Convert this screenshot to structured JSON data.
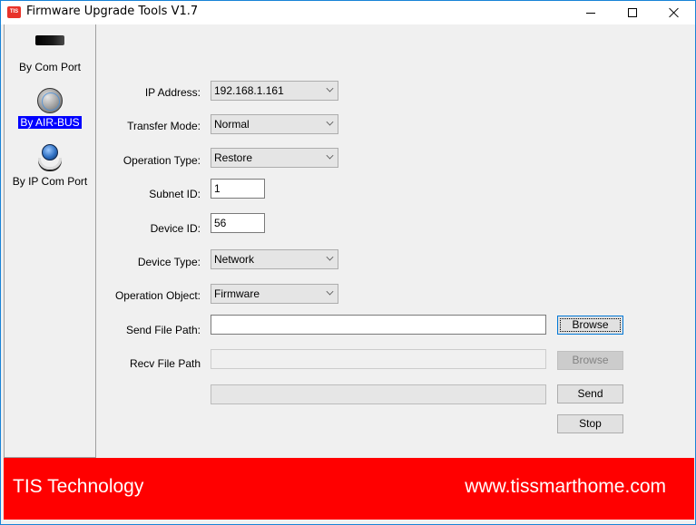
{
  "window": {
    "title": "Firmware Upgrade Tools V1.7",
    "app_icon_text": "TIS"
  },
  "sidebar": {
    "items": [
      {
        "label": "By Com Port",
        "icon": "com-port-icon",
        "selected": false
      },
      {
        "label": "By AIR-BUS",
        "icon": "globe-icon",
        "selected": true
      },
      {
        "label": "By IP Com Port",
        "icon": "ip-network-icon",
        "selected": false
      }
    ]
  },
  "form": {
    "ip_address": {
      "label": "IP Address:",
      "value": "192.168.1.161"
    },
    "transfer_mode": {
      "label": "Transfer Mode:",
      "value": "Normal"
    },
    "operation_type": {
      "label": "Operation Type:",
      "value": "Restore"
    },
    "subnet_id": {
      "label": "Subnet ID:",
      "value": "1"
    },
    "device_id": {
      "label": "Device ID:",
      "value": "56"
    },
    "device_type": {
      "label": "Device Type:",
      "value": "Network"
    },
    "operation_object": {
      "label": "Operation Object:",
      "value": "Firmware"
    },
    "send_file_path": {
      "label": "Send File Path:",
      "value": ""
    },
    "recv_file_path": {
      "label": "Recv File Path",
      "value": ""
    }
  },
  "buttons": {
    "browse_send": "Browse",
    "browse_recv": "Browse",
    "send": "Send",
    "stop": "Stop"
  },
  "progress": {
    "value": 0
  },
  "footer": {
    "company": "TIS Technology",
    "website": "www.tissmarthome.com",
    "color": "#ff0000"
  }
}
